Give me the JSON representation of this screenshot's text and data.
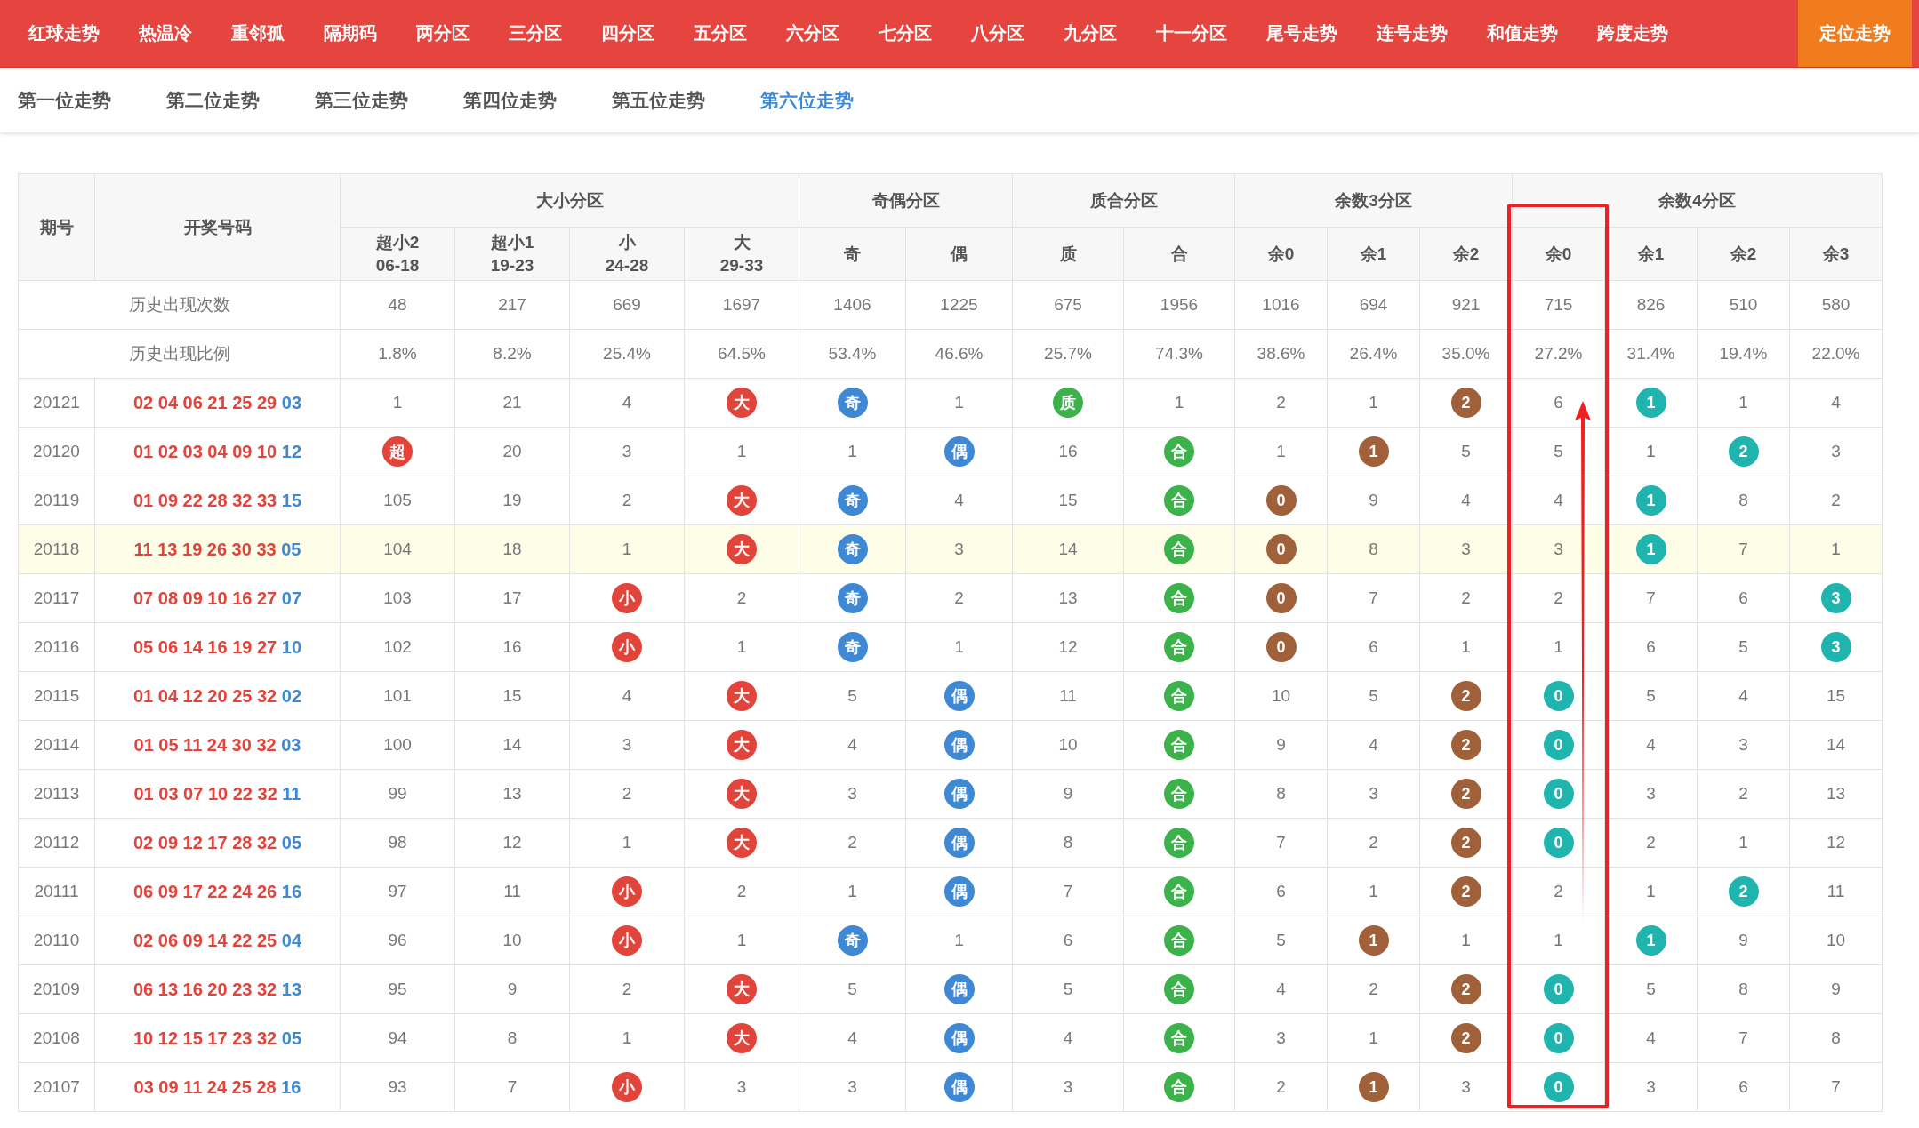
{
  "top_nav": [
    {
      "label": "红球走势",
      "selected": false
    },
    {
      "label": "热温冷",
      "selected": false
    },
    {
      "label": "重邻孤",
      "selected": false
    },
    {
      "label": "隔期码",
      "selected": false
    },
    {
      "label": "两分区",
      "selected": false
    },
    {
      "label": "三分区",
      "selected": false
    },
    {
      "label": "四分区",
      "selected": false
    },
    {
      "label": "五分区",
      "selected": false
    },
    {
      "label": "六分区",
      "selected": false
    },
    {
      "label": "七分区",
      "selected": false
    },
    {
      "label": "八分区",
      "selected": false
    },
    {
      "label": "九分区",
      "selected": false
    },
    {
      "label": "十一分区",
      "selected": false
    },
    {
      "label": "尾号走势",
      "selected": false
    },
    {
      "label": "连号走势",
      "selected": false
    },
    {
      "label": "和值走势",
      "selected": false
    },
    {
      "label": "跨度走势",
      "selected": false
    },
    {
      "label": "定位走势",
      "selected": true
    }
  ],
  "sub_nav": [
    {
      "label": "第一位走势",
      "selected": false
    },
    {
      "label": "第二位走势",
      "selected": false
    },
    {
      "label": "第三位走势",
      "selected": false
    },
    {
      "label": "第四位走势",
      "selected": false
    },
    {
      "label": "第五位走势",
      "selected": false
    },
    {
      "label": "第六位走势",
      "selected": true
    }
  ],
  "table": {
    "period_header": "期号",
    "numbers_header": "开奖号码",
    "groups": [
      {
        "title": "大小分区",
        "color": "#e0443a",
        "columns": [
          {
            "label": "超小2",
            "range": "06-18",
            "annotated": false
          },
          {
            "label": "超小1",
            "range": "19-23",
            "annotated": false
          },
          {
            "label": "小",
            "range": "24-28",
            "annotated": false
          },
          {
            "label": "大",
            "range": "29-33",
            "annotated": false
          }
        ]
      },
      {
        "title": "奇偶分区",
        "color": "#3f88d4",
        "columns": [
          {
            "label": "奇",
            "annotated": false
          },
          {
            "label": "偶",
            "annotated": false
          }
        ]
      },
      {
        "title": "质合分区",
        "color": "#3bb24a",
        "columns": [
          {
            "label": "质",
            "annotated": false
          },
          {
            "label": "合",
            "annotated": false
          }
        ]
      },
      {
        "title": "余数3分区",
        "color": "#a0603a",
        "columns": [
          {
            "label": "余0",
            "annotated": false
          },
          {
            "label": "余1",
            "annotated": false
          },
          {
            "label": "余2",
            "annotated": false
          }
        ]
      },
      {
        "title": "余数4分区",
        "color": "#1fb5ae",
        "columns": [
          {
            "label": "余0",
            "annotated": true
          },
          {
            "label": "余1",
            "annotated": false
          },
          {
            "label": "余2",
            "annotated": false
          },
          {
            "label": "余3",
            "annotated": false
          }
        ]
      }
    ],
    "stats": [
      {
        "label": "历史出现次数",
        "values": [
          "48",
          "217",
          "669",
          "1697",
          "1406",
          "1225",
          "675",
          "1956",
          "1016",
          "694",
          "921",
          "715",
          "826",
          "510",
          "580"
        ]
      },
      {
        "label": "历史出现比例",
        "values": [
          "1.8%",
          "8.2%",
          "25.4%",
          "64.5%",
          "53.4%",
          "46.6%",
          "25.7%",
          "74.3%",
          "38.6%",
          "26.4%",
          "35.0%",
          "27.2%",
          "31.4%",
          "19.4%",
          "22.0%"
        ]
      }
    ],
    "rows": [
      {
        "period": "20121",
        "reds": "02 04 06 21 25 29",
        "blue": "03",
        "highlighted": false,
        "cells": [
          {
            "t": "1",
            "hit": false
          },
          {
            "t": "21",
            "hit": false
          },
          {
            "t": "4",
            "hit": false
          },
          {
            "t": "大",
            "hit": true
          },
          {
            "t": "奇",
            "hit": true
          },
          {
            "t": "1",
            "hit": false
          },
          {
            "t": "质",
            "hit": true
          },
          {
            "t": "1",
            "hit": false
          },
          {
            "t": "2",
            "hit": false
          },
          {
            "t": "1",
            "hit": false
          },
          {
            "t": "2",
            "hit": true
          },
          {
            "t": "6",
            "hit": false
          },
          {
            "t": "1",
            "hit": true
          },
          {
            "t": "1",
            "hit": false
          },
          {
            "t": "4",
            "hit": false
          }
        ]
      },
      {
        "period": "20120",
        "reds": "01 02 03 04 09 10",
        "blue": "12",
        "highlighted": false,
        "cells": [
          {
            "t": "超",
            "hit": true
          },
          {
            "t": "20",
            "hit": false
          },
          {
            "t": "3",
            "hit": false
          },
          {
            "t": "1",
            "hit": false
          },
          {
            "t": "1",
            "hit": false
          },
          {
            "t": "偶",
            "hit": true
          },
          {
            "t": "16",
            "hit": false
          },
          {
            "t": "合",
            "hit": true
          },
          {
            "t": "1",
            "hit": false
          },
          {
            "t": "1",
            "hit": true
          },
          {
            "t": "5",
            "hit": false
          },
          {
            "t": "5",
            "hit": false
          },
          {
            "t": "1",
            "hit": false
          },
          {
            "t": "2",
            "hit": true
          },
          {
            "t": "3",
            "hit": false
          }
        ]
      },
      {
        "period": "20119",
        "reds": "01 09 22 28 32 33",
        "blue": "15",
        "highlighted": false,
        "cells": [
          {
            "t": "105",
            "hit": false
          },
          {
            "t": "19",
            "hit": false
          },
          {
            "t": "2",
            "hit": false
          },
          {
            "t": "大",
            "hit": true
          },
          {
            "t": "奇",
            "hit": true
          },
          {
            "t": "4",
            "hit": false
          },
          {
            "t": "15",
            "hit": false
          },
          {
            "t": "合",
            "hit": true
          },
          {
            "t": "0",
            "hit": true
          },
          {
            "t": "9",
            "hit": false
          },
          {
            "t": "4",
            "hit": false
          },
          {
            "t": "4",
            "hit": false
          },
          {
            "t": "1",
            "hit": true
          },
          {
            "t": "8",
            "hit": false
          },
          {
            "t": "2",
            "hit": false
          }
        ]
      },
      {
        "period": "20118",
        "reds": "11 13 19 26 30 33",
        "blue": "05",
        "highlighted": true,
        "cells": [
          {
            "t": "104",
            "hit": false
          },
          {
            "t": "18",
            "hit": false
          },
          {
            "t": "1",
            "hit": false
          },
          {
            "t": "大",
            "hit": true
          },
          {
            "t": "奇",
            "hit": true
          },
          {
            "t": "3",
            "hit": false
          },
          {
            "t": "14",
            "hit": false
          },
          {
            "t": "合",
            "hit": true
          },
          {
            "t": "0",
            "hit": true
          },
          {
            "t": "8",
            "hit": false
          },
          {
            "t": "3",
            "hit": false
          },
          {
            "t": "3",
            "hit": false
          },
          {
            "t": "1",
            "hit": true
          },
          {
            "t": "7",
            "hit": false
          },
          {
            "t": "1",
            "hit": false
          }
        ]
      },
      {
        "period": "20117",
        "reds": "07 08 09 10 16 27",
        "blue": "07",
        "highlighted": false,
        "cells": [
          {
            "t": "103",
            "hit": false
          },
          {
            "t": "17",
            "hit": false
          },
          {
            "t": "小",
            "hit": true
          },
          {
            "t": "2",
            "hit": false
          },
          {
            "t": "奇",
            "hit": true
          },
          {
            "t": "2",
            "hit": false
          },
          {
            "t": "13",
            "hit": false
          },
          {
            "t": "合",
            "hit": true
          },
          {
            "t": "0",
            "hit": true
          },
          {
            "t": "7",
            "hit": false
          },
          {
            "t": "2",
            "hit": false
          },
          {
            "t": "2",
            "hit": false
          },
          {
            "t": "7",
            "hit": false
          },
          {
            "t": "6",
            "hit": false
          },
          {
            "t": "3",
            "hit": true
          }
        ]
      },
      {
        "period": "20116",
        "reds": "05 06 14 16 19 27",
        "blue": "10",
        "highlighted": false,
        "cells": [
          {
            "t": "102",
            "hit": false
          },
          {
            "t": "16",
            "hit": false
          },
          {
            "t": "小",
            "hit": true
          },
          {
            "t": "1",
            "hit": false
          },
          {
            "t": "奇",
            "hit": true
          },
          {
            "t": "1",
            "hit": false
          },
          {
            "t": "12",
            "hit": false
          },
          {
            "t": "合",
            "hit": true
          },
          {
            "t": "0",
            "hit": true
          },
          {
            "t": "6",
            "hit": false
          },
          {
            "t": "1",
            "hit": false
          },
          {
            "t": "1",
            "hit": false
          },
          {
            "t": "6",
            "hit": false
          },
          {
            "t": "5",
            "hit": false
          },
          {
            "t": "3",
            "hit": true
          }
        ]
      },
      {
        "period": "20115",
        "reds": "01 04 12 20 25 32",
        "blue": "02",
        "highlighted": false,
        "cells": [
          {
            "t": "101",
            "hit": false
          },
          {
            "t": "15",
            "hit": false
          },
          {
            "t": "4",
            "hit": false
          },
          {
            "t": "大",
            "hit": true
          },
          {
            "t": "5",
            "hit": false
          },
          {
            "t": "偶",
            "hit": true
          },
          {
            "t": "11",
            "hit": false
          },
          {
            "t": "合",
            "hit": true
          },
          {
            "t": "10",
            "hit": false
          },
          {
            "t": "5",
            "hit": false
          },
          {
            "t": "2",
            "hit": true
          },
          {
            "t": "0",
            "hit": true
          },
          {
            "t": "5",
            "hit": false
          },
          {
            "t": "4",
            "hit": false
          },
          {
            "t": "15",
            "hit": false
          }
        ]
      },
      {
        "period": "20114",
        "reds": "01 05 11 24 30 32",
        "blue": "03",
        "highlighted": false,
        "cells": [
          {
            "t": "100",
            "hit": false
          },
          {
            "t": "14",
            "hit": false
          },
          {
            "t": "3",
            "hit": false
          },
          {
            "t": "大",
            "hit": true
          },
          {
            "t": "4",
            "hit": false
          },
          {
            "t": "偶",
            "hit": true
          },
          {
            "t": "10",
            "hit": false
          },
          {
            "t": "合",
            "hit": true
          },
          {
            "t": "9",
            "hit": false
          },
          {
            "t": "4",
            "hit": false
          },
          {
            "t": "2",
            "hit": true
          },
          {
            "t": "0",
            "hit": true
          },
          {
            "t": "4",
            "hit": false
          },
          {
            "t": "3",
            "hit": false
          },
          {
            "t": "14",
            "hit": false
          }
        ]
      },
      {
        "period": "20113",
        "reds": "01 03 07 10 22 32",
        "blue": "11",
        "highlighted": false,
        "cells": [
          {
            "t": "99",
            "hit": false
          },
          {
            "t": "13",
            "hit": false
          },
          {
            "t": "2",
            "hit": false
          },
          {
            "t": "大",
            "hit": true
          },
          {
            "t": "3",
            "hit": false
          },
          {
            "t": "偶",
            "hit": true
          },
          {
            "t": "9",
            "hit": false
          },
          {
            "t": "合",
            "hit": true
          },
          {
            "t": "8",
            "hit": false
          },
          {
            "t": "3",
            "hit": false
          },
          {
            "t": "2",
            "hit": true
          },
          {
            "t": "0",
            "hit": true
          },
          {
            "t": "3",
            "hit": false
          },
          {
            "t": "2",
            "hit": false
          },
          {
            "t": "13",
            "hit": false
          }
        ]
      },
      {
        "period": "20112",
        "reds": "02 09 12 17 28 32",
        "blue": "05",
        "highlighted": false,
        "cells": [
          {
            "t": "98",
            "hit": false
          },
          {
            "t": "12",
            "hit": false
          },
          {
            "t": "1",
            "hit": false
          },
          {
            "t": "大",
            "hit": true
          },
          {
            "t": "2",
            "hit": false
          },
          {
            "t": "偶",
            "hit": true
          },
          {
            "t": "8",
            "hit": false
          },
          {
            "t": "合",
            "hit": true
          },
          {
            "t": "7",
            "hit": false
          },
          {
            "t": "2",
            "hit": false
          },
          {
            "t": "2",
            "hit": true
          },
          {
            "t": "0",
            "hit": true
          },
          {
            "t": "2",
            "hit": false
          },
          {
            "t": "1",
            "hit": false
          },
          {
            "t": "12",
            "hit": false
          }
        ]
      },
      {
        "period": "20111",
        "reds": "06 09 17 22 24 26",
        "blue": "16",
        "highlighted": false,
        "cells": [
          {
            "t": "97",
            "hit": false
          },
          {
            "t": "11",
            "hit": false
          },
          {
            "t": "小",
            "hit": true
          },
          {
            "t": "2",
            "hit": false
          },
          {
            "t": "1",
            "hit": false
          },
          {
            "t": "偶",
            "hit": true
          },
          {
            "t": "7",
            "hit": false
          },
          {
            "t": "合",
            "hit": true
          },
          {
            "t": "6",
            "hit": false
          },
          {
            "t": "1",
            "hit": false
          },
          {
            "t": "2",
            "hit": true
          },
          {
            "t": "2",
            "hit": false
          },
          {
            "t": "1",
            "hit": false
          },
          {
            "t": "2",
            "hit": true
          },
          {
            "t": "11",
            "hit": false
          }
        ]
      },
      {
        "period": "20110",
        "reds": "02 06 09 14 22 25",
        "blue": "04",
        "highlighted": false,
        "cells": [
          {
            "t": "96",
            "hit": false
          },
          {
            "t": "10",
            "hit": false
          },
          {
            "t": "小",
            "hit": true
          },
          {
            "t": "1",
            "hit": false
          },
          {
            "t": "奇",
            "hit": true
          },
          {
            "t": "1",
            "hit": false
          },
          {
            "t": "6",
            "hit": false
          },
          {
            "t": "合",
            "hit": true
          },
          {
            "t": "5",
            "hit": false
          },
          {
            "t": "1",
            "hit": true
          },
          {
            "t": "1",
            "hit": false
          },
          {
            "t": "1",
            "hit": false
          },
          {
            "t": "1",
            "hit": true
          },
          {
            "t": "9",
            "hit": false
          },
          {
            "t": "10",
            "hit": false
          }
        ]
      },
      {
        "period": "20109",
        "reds": "06 13 16 20 23 32",
        "blue": "13",
        "highlighted": false,
        "cells": [
          {
            "t": "95",
            "hit": false
          },
          {
            "t": "9",
            "hit": false
          },
          {
            "t": "2",
            "hit": false
          },
          {
            "t": "大",
            "hit": true
          },
          {
            "t": "5",
            "hit": false
          },
          {
            "t": "偶",
            "hit": true
          },
          {
            "t": "5",
            "hit": false
          },
          {
            "t": "合",
            "hit": true
          },
          {
            "t": "4",
            "hit": false
          },
          {
            "t": "2",
            "hit": false
          },
          {
            "t": "2",
            "hit": true
          },
          {
            "t": "0",
            "hit": true
          },
          {
            "t": "5",
            "hit": false
          },
          {
            "t": "8",
            "hit": false
          },
          {
            "t": "9",
            "hit": false
          }
        ]
      },
      {
        "period": "20108",
        "reds": "10 12 15 17 23 32",
        "blue": "05",
        "highlighted": false,
        "cells": [
          {
            "t": "94",
            "hit": false
          },
          {
            "t": "8",
            "hit": false
          },
          {
            "t": "1",
            "hit": false
          },
          {
            "t": "大",
            "hit": true
          },
          {
            "t": "4",
            "hit": false
          },
          {
            "t": "偶",
            "hit": true
          },
          {
            "t": "4",
            "hit": false
          },
          {
            "t": "合",
            "hit": true
          },
          {
            "t": "3",
            "hit": false
          },
          {
            "t": "1",
            "hit": false
          },
          {
            "t": "2",
            "hit": true
          },
          {
            "t": "0",
            "hit": true
          },
          {
            "t": "4",
            "hit": false
          },
          {
            "t": "7",
            "hit": false
          },
          {
            "t": "8",
            "hit": false
          }
        ]
      },
      {
        "period": "20107",
        "reds": "03 09 11 24 25 28",
        "blue": "16",
        "highlighted": false,
        "cells": [
          {
            "t": "93",
            "hit": false
          },
          {
            "t": "7",
            "hit": false
          },
          {
            "t": "小",
            "hit": true
          },
          {
            "t": "3",
            "hit": false
          },
          {
            "t": "3",
            "hit": false
          },
          {
            "t": "偶",
            "hit": true
          },
          {
            "t": "3",
            "hit": false
          },
          {
            "t": "合",
            "hit": true
          },
          {
            "t": "2",
            "hit": false
          },
          {
            "t": "1",
            "hit": true
          },
          {
            "t": "3",
            "hit": false
          },
          {
            "t": "0",
            "hit": true
          },
          {
            "t": "3",
            "hit": false
          },
          {
            "t": "6",
            "hit": false
          },
          {
            "t": "7",
            "hit": false
          }
        ]
      }
    ]
  }
}
